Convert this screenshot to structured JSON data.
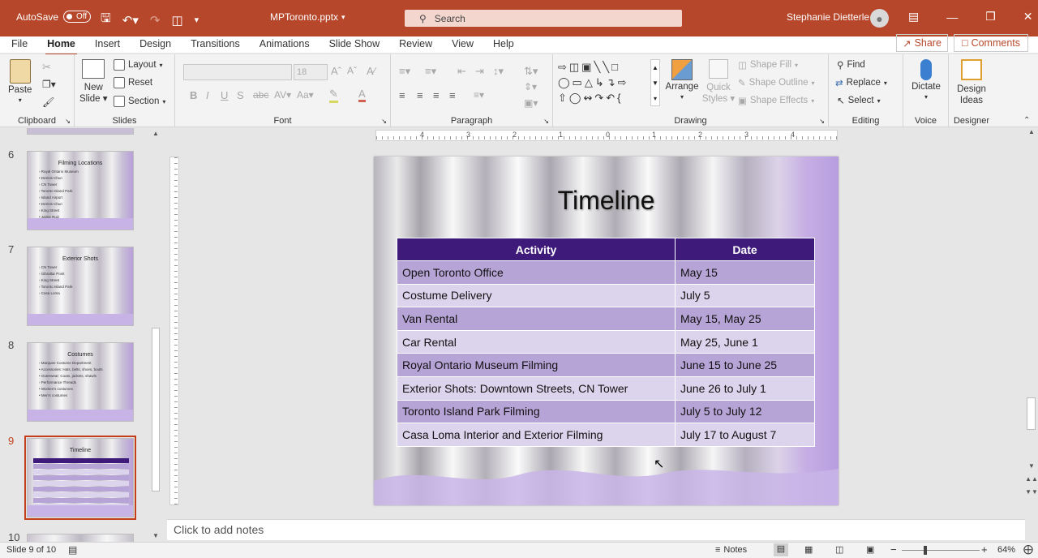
{
  "titlebar": {
    "autosave_label": "AutoSave",
    "autosave_state": "Off",
    "filename": "MPToronto.pptx",
    "search_placeholder": "Search",
    "user_name": "Stephanie Dietterle"
  },
  "tabs": [
    "File",
    "Home",
    "Insert",
    "Design",
    "Transitions",
    "Animations",
    "Slide Show",
    "Review",
    "View",
    "Help"
  ],
  "share_label": "Share",
  "comments_label": "Comments",
  "ribbon": {
    "clipboard": {
      "label": "Clipboard",
      "paste": "Paste"
    },
    "slides": {
      "label": "Slides",
      "new_slide_1": "New",
      "new_slide_2": "Slide",
      "layout": "Layout",
      "reset": "Reset",
      "section": "Section"
    },
    "font": {
      "label": "Font",
      "size": "18"
    },
    "paragraph": {
      "label": "Paragraph"
    },
    "drawing": {
      "label": "Drawing",
      "arrange": "Arrange",
      "quick_styles_1": "Quick",
      "quick_styles_2": "Styles",
      "shape_fill": "Shape Fill",
      "shape_outline": "Shape Outline",
      "shape_effects": "Shape Effects"
    },
    "editing": {
      "label": "Editing",
      "find": "Find",
      "replace": "Replace",
      "select": "Select"
    },
    "voice": {
      "label": "Voice",
      "dictate": "Dictate"
    },
    "designer": {
      "label": "Designer",
      "design_ideas_1": "Design",
      "design_ideas_2": "Ideas"
    }
  },
  "thumbnails": [
    {
      "num": "6",
      "title": "Filming Locations",
      "lines": [
        "› Royal Ontario Museum",
        "   • Dennis Chun",
        "› CN Tower",
        "› Toronto Island Park",
        "› Island Airport",
        "   • Dennis Chun",
        "› King Street",
        "   • Jaime Ruiz"
      ]
    },
    {
      "num": "7",
      "title": "Exterior Shots",
      "lines": [
        "› CN Tower",
        "› Gibraltar Point",
        "› King Street",
        "› Toronto Island Park",
        "› Casa Loma"
      ]
    },
    {
      "num": "8",
      "title": "Costumes",
      "lines": [
        "› Marquee Costume Department",
        "   • Accessories: Hats, belts, shoes, boots",
        "   • Outerwear: Coats, jackets, shawls",
        "› Performance Threads",
        "   • Women's costumes",
        "   • Men's costumes"
      ]
    },
    {
      "num": "9",
      "title": "Timeline",
      "lines": []
    },
    {
      "num": "10",
      "title": "",
      "lines": []
    }
  ],
  "slide": {
    "title": "Timeline",
    "table": {
      "headers": [
        "Activity",
        "Date"
      ],
      "rows": [
        [
          "Open Toronto Office",
          "May 15"
        ],
        [
          "Costume Delivery",
          "July 5"
        ],
        [
          "Van Rental",
          "May 15, May 25"
        ],
        [
          "Car Rental",
          "May 25, June 1"
        ],
        [
          "Royal Ontario Museum Filming",
          "June 15 to June 25"
        ],
        [
          "Exterior Shots: Downtown Streets, CN Tower",
          "June 26 to July 1"
        ],
        [
          "Toronto Island Park Filming",
          "July 5 to July 12"
        ],
        [
          "Casa Loma Interior and Exterior Filming",
          "July 17 to August 7"
        ]
      ]
    }
  },
  "ruler_ticks": [
    "4",
    "3",
    "2",
    "1",
    "0",
    "1",
    "2",
    "3",
    "4"
  ],
  "notes_placeholder": "Click to add notes",
  "status": {
    "slide_info": "Slide 9 of 10",
    "notes_label": "Notes",
    "zoom": "64%"
  },
  "colors": {
    "accent": "#b7472a",
    "table_header": "#3e1b7a"
  }
}
